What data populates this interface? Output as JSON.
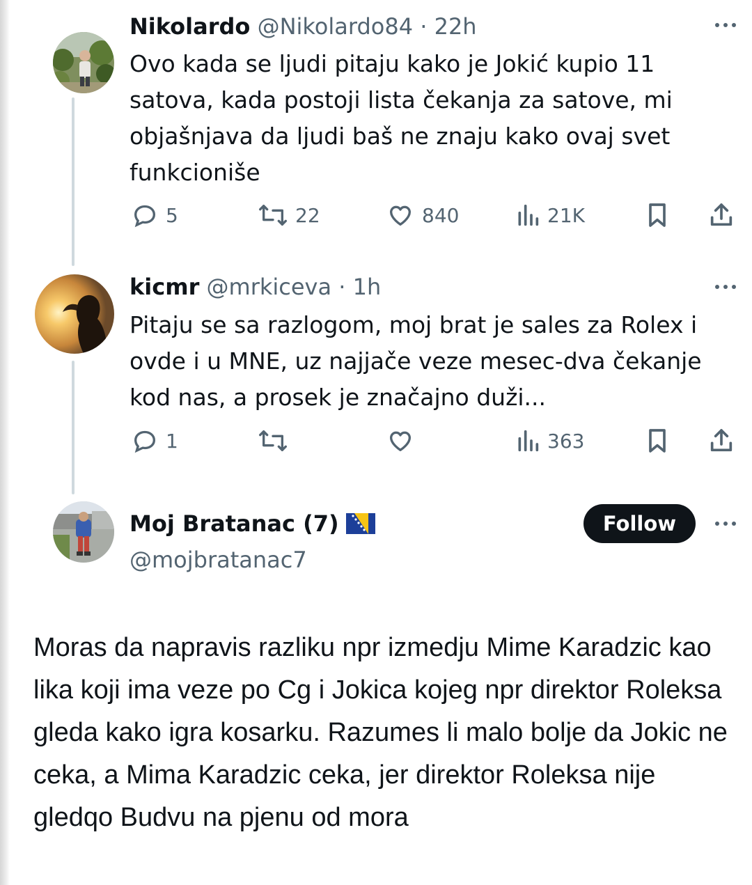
{
  "tweets": [
    {
      "name": "Nikolardo",
      "handle": "@Nikolardo84",
      "separator": " · ",
      "time": "22h",
      "text": "Ovo kada se ljudi pitaju kako je Jokić kupio 11 satova, kada postoji lista čekanja za satove, mi objašnjava da ljudi baš ne znaju kako ovaj svet funkcioniše",
      "replies": "5",
      "retweets": "22",
      "likes": "840",
      "views": "21K",
      "more_icon": "ellipsis-icon"
    },
    {
      "name": "kicmr",
      "handle": "@mrkiceva",
      "separator": " · ",
      "time": "1h",
      "text": "Pitaju se sa razlogom, moj brat je sales za Rolex i ovde i u MNE, uz najjače veze mesec-dva čekanje kod nas, a prosek je značajno duži...",
      "replies": "1",
      "retweets": "",
      "likes": "",
      "views": "363",
      "more_icon": "ellipsis-icon"
    }
  ],
  "main_tweet": {
    "name": "Moj Bratanac (7)",
    "handle": "@mojbratanac7",
    "follow_label": "Follow",
    "flag_icon": "bosnia-flag-icon",
    "text": "Moras da napravis razliku npr izmedju Mime Karadzic kao lika koji ima veze po Cg i Jokica kojeg npr direktor Roleksa gleda kako igra kosarku. Razumes li malo bolje da Jokic ne ceka, a Mima Karadzic ceka, jer direktor Roleksa nije gledqo Budvu na pjenu od mora"
  },
  "colors": {
    "text": "#0f1419",
    "secondary": "#536471",
    "thread_line": "#cfd9de",
    "follow_bg": "#0f1419",
    "follow_text": "#ffffff"
  }
}
